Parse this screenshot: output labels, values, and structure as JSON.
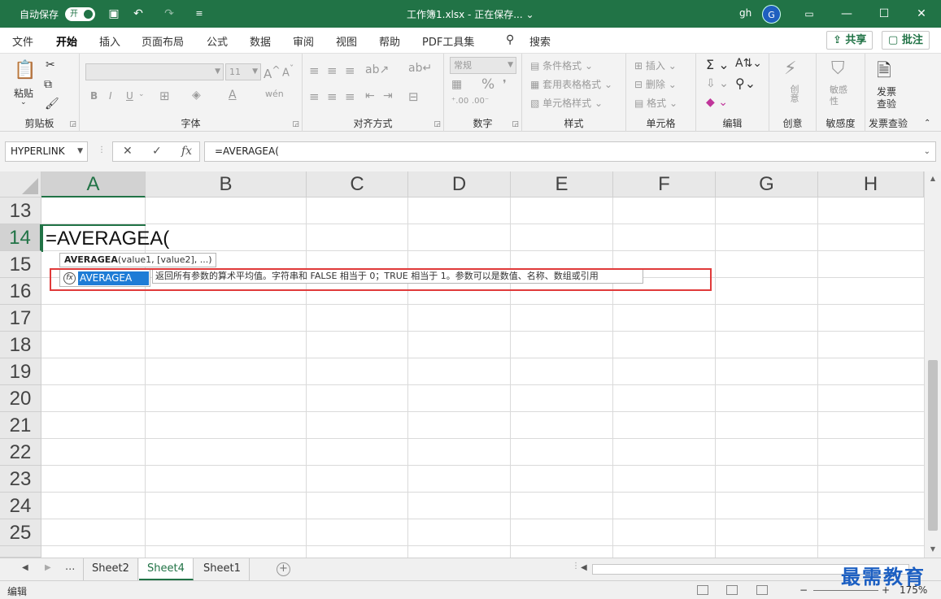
{
  "titlebar": {
    "autosave_label": "自动保存",
    "autosave_state": "开",
    "doc_title": "工作簿1.xlsx  -  正在保存... ⌄",
    "user": "gh",
    "avatar_initial": "G",
    "icons": [
      "save-icon",
      "undo-icon",
      "redo-icon",
      "customize-icon",
      "ribbon-display-icon",
      "minimize-icon",
      "maximize-icon",
      "close-icon"
    ]
  },
  "tabs": [
    "文件",
    "开始",
    "插入",
    "页面布局",
    "公式",
    "数据",
    "审阅",
    "视图",
    "帮助",
    "PDF工具集"
  ],
  "active_tab": "开始",
  "search_label": "搜索",
  "share_label": "共享",
  "comments_label": "批注",
  "ribbon": {
    "clipboard": {
      "label": "剪贴板",
      "paste": "粘贴"
    },
    "font": {
      "label": "字体",
      "size": "11",
      "bold": "B",
      "italic": "I",
      "underline": "U"
    },
    "alignment": {
      "label": "对齐方式"
    },
    "number": {
      "label": "数字",
      "format": "常规"
    },
    "styles": {
      "label": "样式",
      "conditional": "条件格式",
      "table": "套用表格格式",
      "cell": "单元格样式"
    },
    "cells": {
      "label": "单元格",
      "insert": "插入",
      "delete": "删除",
      "format": "格式"
    },
    "editing": {
      "label": "编辑"
    },
    "ideas": {
      "label": "创意",
      "button": "创意"
    },
    "sensitivity": {
      "label": "敏感度",
      "button": "敏感性"
    },
    "invoice": {
      "label": "发票查验",
      "button_line1": "发票",
      "button_line2": "查验"
    }
  },
  "formula_bar": {
    "name_box": "HYPERLINK",
    "cancel": "✕",
    "enter": "✓",
    "fx": "fx",
    "formula": "=AVERAGEA("
  },
  "columns": [
    "A",
    "B",
    "C",
    "D",
    "E",
    "F",
    "G",
    "H"
  ],
  "rows": [
    "13",
    "14",
    "15",
    "16",
    "17",
    "18",
    "19",
    "20",
    "21",
    "22",
    "23",
    "24",
    "25"
  ],
  "active_cell_text": "=AVERAGEA(",
  "autocomplete": {
    "signature_fn": "AVERAGEA",
    "signature_args": "(value1, [value2], ...)",
    "item": "AVERAGEA",
    "fx_glyph": "fx",
    "description": "返回所有参数的算术平均值。字符串和 FALSE 相当于 0；TRUE 相当于 1。参数可以是数值、名称、数组或引用"
  },
  "sheets": [
    "Sheet2",
    "Sheet4",
    "Sheet1"
  ],
  "active_sheet": "Sheet4",
  "sheet_nav_more": "...",
  "add_sheet": "+",
  "status": {
    "mode": "编辑",
    "zoom": "175%",
    "minus": "−",
    "plus": "+"
  },
  "watermark": "最需教育",
  "accent_color": "#217346"
}
